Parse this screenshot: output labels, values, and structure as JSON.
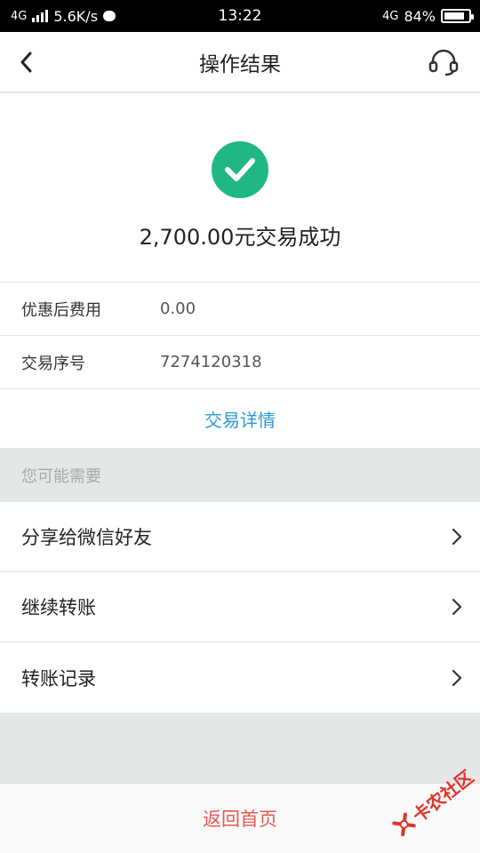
{
  "status_bar": {
    "network_type": "4G",
    "speed": "5.6K/s",
    "time": "13:22",
    "right_network": "4G",
    "battery": "84%",
    "battery_level": 0.84
  },
  "nav": {
    "title": "操作结果",
    "back_icon": "chevron-left-icon",
    "support_icon": "headset-icon"
  },
  "result": {
    "status_icon": "check-circle-icon",
    "status_color": "#20b786",
    "message": "2,700.00元交易成功"
  },
  "info": [
    {
      "label": "优惠后费用",
      "value": "0.00"
    },
    {
      "label": "交易序号",
      "value": "7274120318"
    }
  ],
  "detail_link": "交易详情",
  "section_header": "您可能需要",
  "menu": [
    {
      "label": "分享给微信好友"
    },
    {
      "label": "继续转账"
    },
    {
      "label": "转账记录"
    }
  ],
  "bottom_button": "返回首页",
  "watermark": "卡农社区",
  "colors": {
    "accent_blue": "#2d9bd6",
    "return_red": "#e45a4f",
    "success_green": "#20b786"
  }
}
